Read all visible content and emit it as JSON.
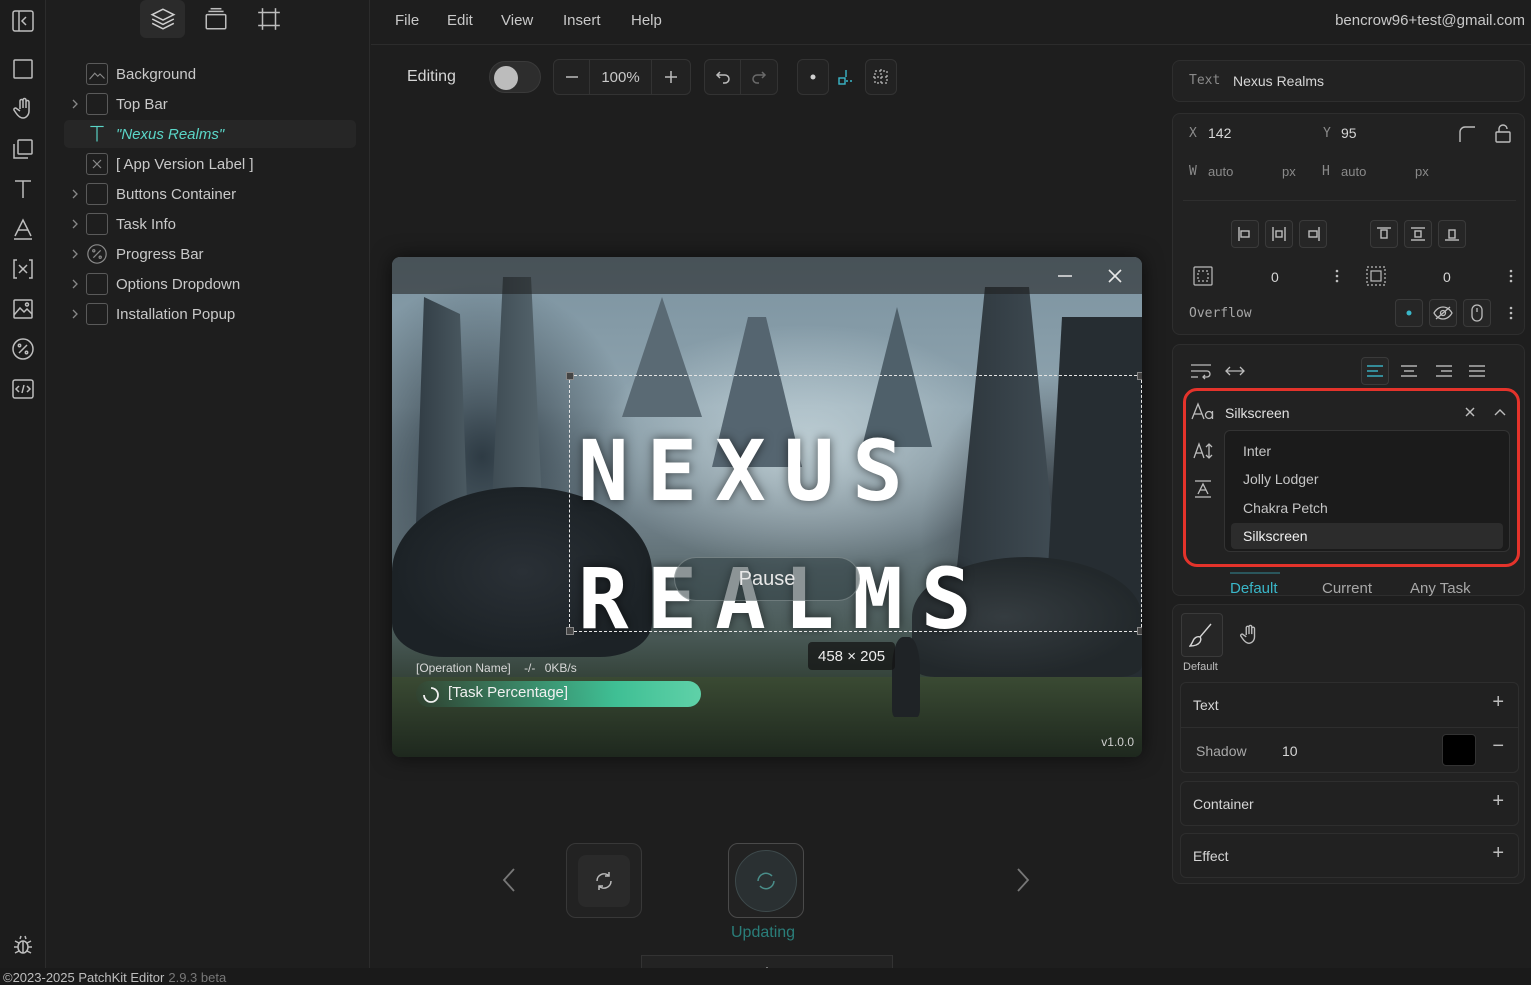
{
  "menu": {
    "items": [
      "File",
      "Edit",
      "View",
      "Insert",
      "Help"
    ],
    "user_email": "bencrow96+test@gmail.com"
  },
  "layers": [
    {
      "label": "Background",
      "icon": "image-icon",
      "expandable": false
    },
    {
      "label": "Top Bar",
      "icon": "container-icon",
      "expandable": true
    },
    {
      "label": "\"Nexus Realms\"",
      "icon": "text-icon",
      "expandable": false,
      "selected": true
    },
    {
      "label": "[ App Version Label ]",
      "icon": "variable-icon",
      "expandable": false
    },
    {
      "label": "Buttons Container",
      "icon": "container-icon",
      "expandable": true
    },
    {
      "label": "Task Info",
      "icon": "container-icon",
      "expandable": true
    },
    {
      "label": "Progress Bar",
      "icon": "percent-icon",
      "expandable": true
    },
    {
      "label": "Options Dropdown",
      "icon": "container-icon",
      "expandable": true
    },
    {
      "label": "Installation Popup",
      "icon": "container-icon",
      "expandable": true
    }
  ],
  "toolbar": {
    "mode_label": "Editing",
    "zoom": "100%"
  },
  "preview": {
    "title_line1": "NEXUS",
    "title_line2": "REALMS",
    "pause_label": "Pause",
    "selection_size": "458 × 205",
    "operation_label": "[Operation Name]",
    "speed_sep": "-/-",
    "speed": "0KB/s",
    "task_percentage": "[Task Percentage]",
    "version": "v1.0.0",
    "progress": 0.38
  },
  "states_below": {
    "updating_label": "Updating"
  },
  "status_bar": {
    "copyright": "©2023-2025 PatchKit Editor",
    "version": "2.9.3 beta"
  },
  "inspector": {
    "element_type": "Text",
    "element_name": "Nexus Realms",
    "x_label": "X",
    "x": "142",
    "y_label": "Y",
    "y": "95",
    "w_label": "W",
    "w": "auto",
    "w_unit": "px",
    "h_label": "H",
    "h": "auto",
    "h_unit": "px",
    "padding": "0",
    "margin": "0",
    "overflow_label": "Overflow",
    "font": {
      "selected": "Silkscreen",
      "options": [
        "Inter",
        "Jolly Lodger",
        "Chakra Petch",
        "Silkscreen"
      ]
    },
    "state_tabs": [
      "Default",
      "Current",
      "Any Task"
    ],
    "style_state_label": "Default",
    "sections": {
      "text_label": "Text",
      "shadow_label": "Shadow",
      "shadow_value": "10",
      "shadow_color": "#000000",
      "container_label": "Container",
      "effect_label": "Effect"
    }
  },
  "colors": {
    "accent": "#3ab7c9",
    "highlight_box": "#e4332b",
    "progress": "#3fbf94"
  }
}
